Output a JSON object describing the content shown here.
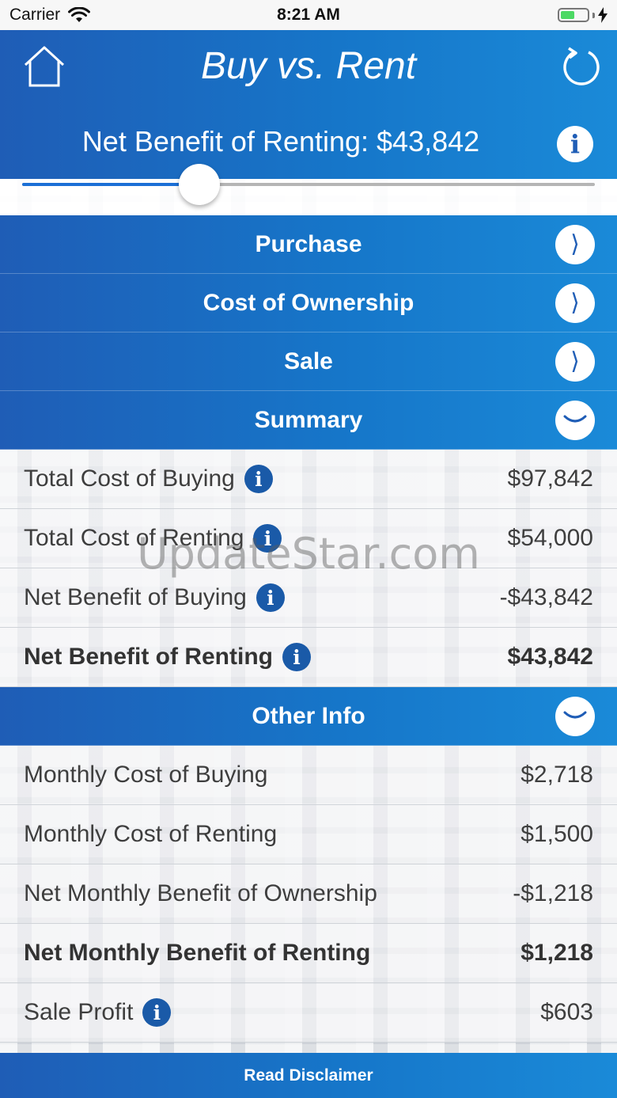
{
  "status_bar": {
    "carrier": "Carrier",
    "time": "8:21 AM"
  },
  "header": {
    "title": "Buy vs. Rent",
    "net_benefit": "Net Benefit of Renting: $43,842"
  },
  "slider": {
    "value_fraction": 0.31
  },
  "sections": [
    {
      "label": "Purchase",
      "state": "collapsed"
    },
    {
      "label": "Cost of Ownership",
      "state": "collapsed"
    },
    {
      "label": "Sale",
      "state": "collapsed"
    },
    {
      "label": "Summary",
      "state": "expanded"
    },
    {
      "label": "Other Info",
      "state": "expanded"
    }
  ],
  "summary_rows": [
    {
      "label": "Total Cost of Buying",
      "value": "$97,842"
    },
    {
      "label": "Total Cost of Renting",
      "value": "$54,000"
    },
    {
      "label": "Net Benefit of Buying",
      "value": "-$43,842"
    },
    {
      "label": "Net Benefit of Renting",
      "value": "$43,842"
    }
  ],
  "other_rows": [
    {
      "label": "Monthly Cost of Buying",
      "value": "$2,718"
    },
    {
      "label": "Monthly Cost of Renting",
      "value": "$1,500"
    },
    {
      "label": "Net Monthly Benefit of Ownership",
      "value": "-$1,218"
    },
    {
      "label": "Net Monthly Benefit of Renting",
      "value": "$1,218"
    },
    {
      "label": "Sale Profit",
      "value": "$603"
    }
  ],
  "watermark": "UpdateStar.com",
  "footer": {
    "label": "Read Disclaimer"
  },
  "icons": {
    "home": "home-icon",
    "refresh": "refresh-icon",
    "info": "info-icon",
    "chevron_right": "chevron-right-icon",
    "chevron_down": "chevron-down-icon",
    "wifi": "wifi-icon",
    "battery": "battery-icon",
    "charging": "charging-icon",
    "info_glyph": "i",
    "chevron_right_glyph": "⟩"
  },
  "colors": {
    "accent": "#1a6fc9",
    "info_dark": "#1a5aa8",
    "battery": "#4cd964"
  }
}
